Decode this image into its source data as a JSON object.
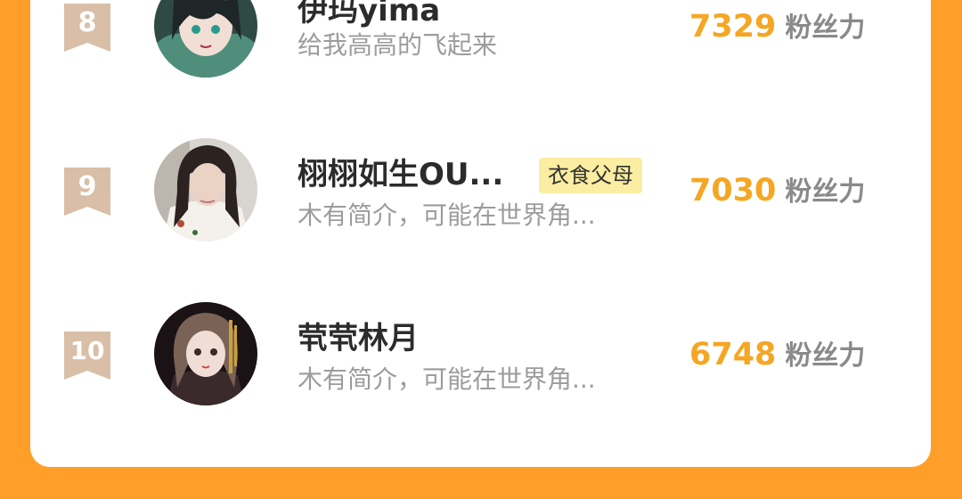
{
  "leaderboard": {
    "rows": [
      {
        "rank": "8",
        "name": "伊玛yima",
        "badge": "",
        "bio": "给我高高的飞起来",
        "score": "7329",
        "score_unit": "粉丝力",
        "avatar_icon": "anime-avatar-icon"
      },
      {
        "rank": "9",
        "name": "栩栩如生OU...",
        "badge": "衣食父母",
        "bio": "木有简介，可能在世界角...",
        "score": "7030",
        "score_unit": "粉丝力",
        "avatar_icon": "user-photo-avatar-icon"
      },
      {
        "rank": "10",
        "name": "茕茕林月",
        "badge": "",
        "bio": "木有简介，可能在世界角...",
        "score": "6748",
        "score_unit": "粉丝力",
        "avatar_icon": "doll-avatar-icon"
      }
    ]
  },
  "colors": {
    "background": "#FF9F2A",
    "score": "#F5A623",
    "ribbon": "#D9BFA7",
    "badge": "#FBEDA1"
  }
}
